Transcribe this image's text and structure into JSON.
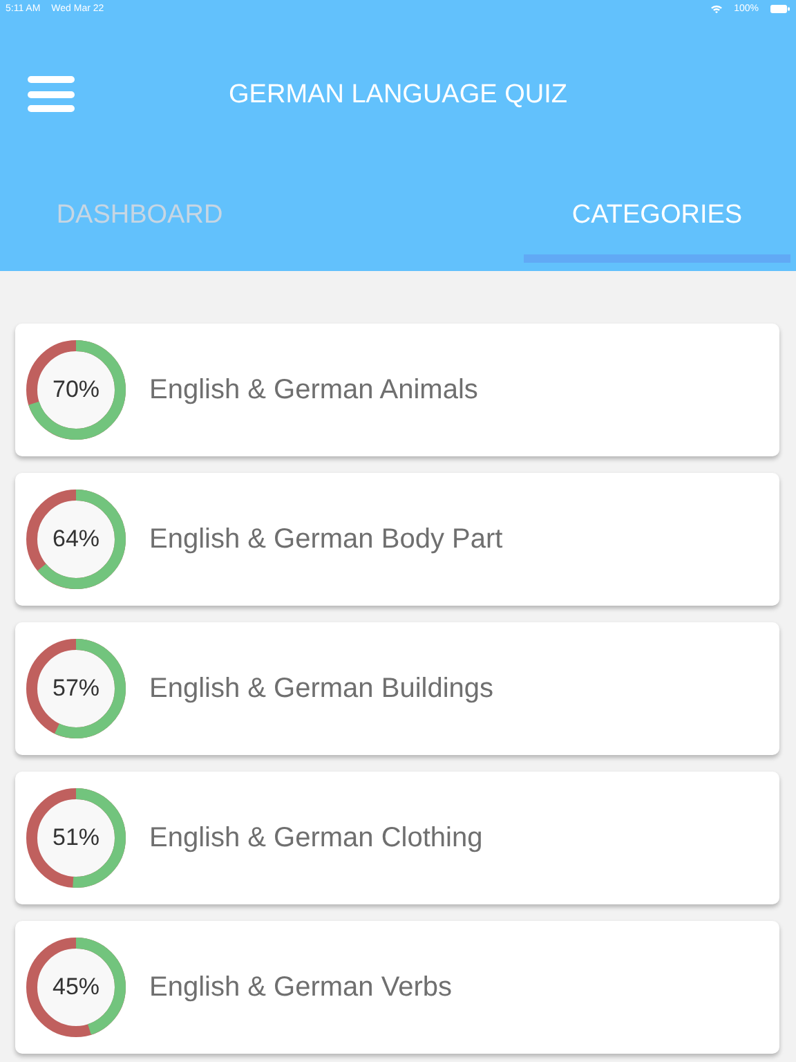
{
  "status_bar": {
    "time": "5:11 AM",
    "date": "Wed Mar 22",
    "battery": "100%"
  },
  "header": {
    "title": "GERMAN LANGUAGE QUIZ"
  },
  "tabs": [
    {
      "label": "DASHBOARD",
      "selected": false
    },
    {
      "label": "CATEGORIES",
      "selected": true
    }
  ],
  "categories": [
    {
      "name": "English & German Animals",
      "percent": "70%",
      "level": 0.7
    },
    {
      "name": "English & German Body Part",
      "percent": "64%",
      "level": 0.64
    },
    {
      "name": "English & German Buildings",
      "percent": "57%",
      "level": 0.57
    },
    {
      "name": "English & German Clothing",
      "percent": "51%",
      "level": 0.51
    },
    {
      "name": "English & German Verbs",
      "percent": "45%",
      "level": 0.45
    }
  ]
}
